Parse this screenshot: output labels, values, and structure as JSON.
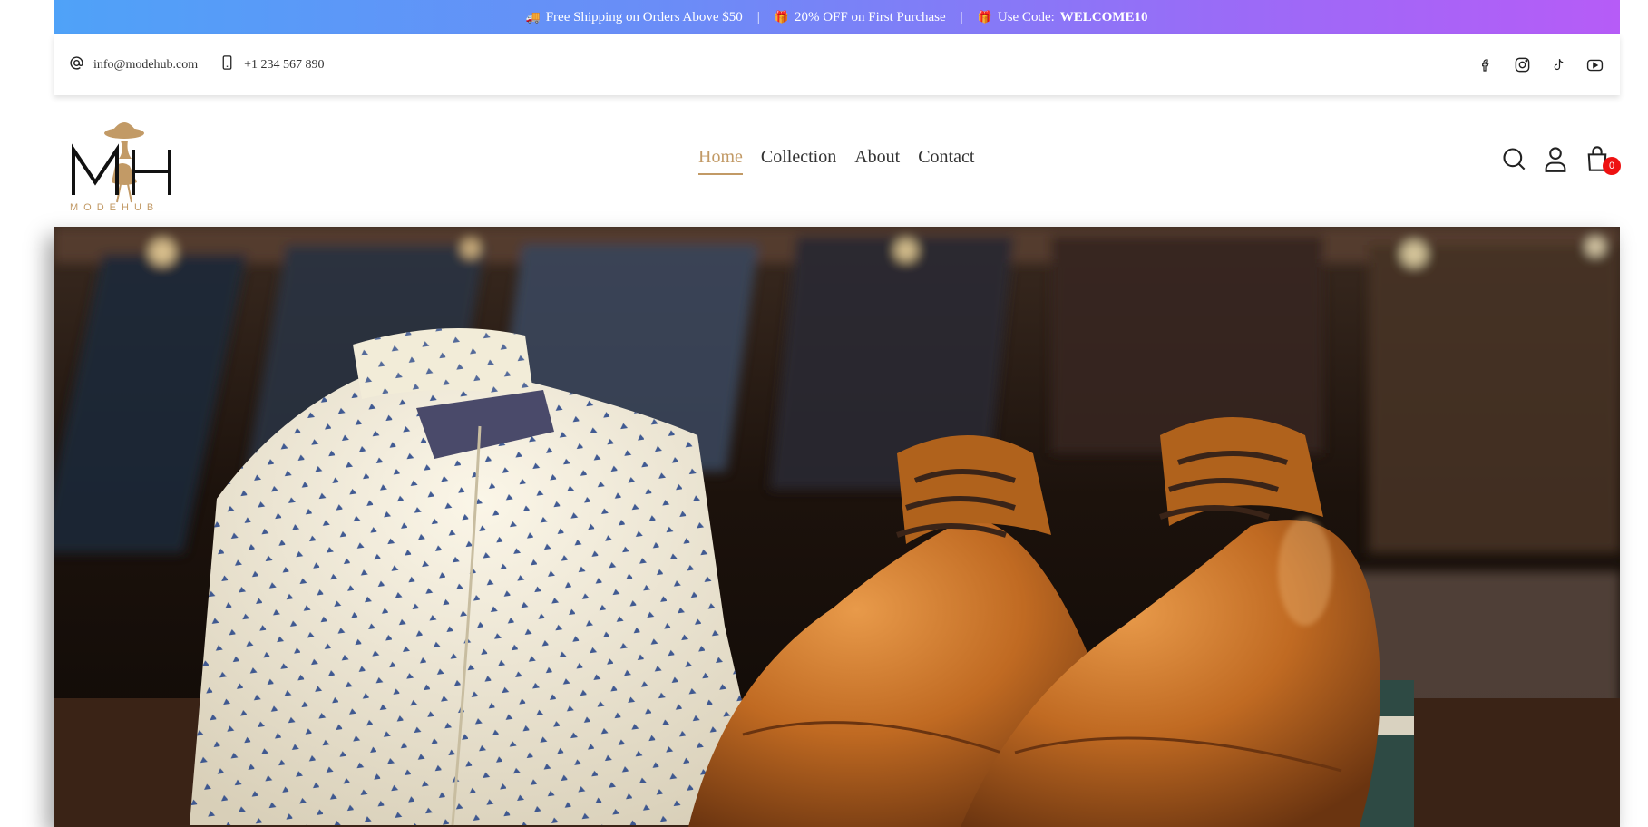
{
  "announcement": {
    "shipping_emoji": "🚚",
    "shipping": "Free Shipping on Orders Above $50",
    "sep": "|",
    "offer_emoji": "🎁",
    "offer": "20% OFF on First Purchase",
    "code_emoji": "🎁",
    "code_prefix": "Use Code:",
    "code": "WELCOME10"
  },
  "contact": {
    "email": "info@modehub.com",
    "phone": "+1 234 567 890"
  },
  "social": [
    "facebook-icon",
    "instagram-icon",
    "tiktok-icon",
    "youtube-icon"
  ],
  "logo": {
    "monogram": "MH",
    "brand": "MODEHUB"
  },
  "nav": [
    {
      "label": "Home",
      "active": true
    },
    {
      "label": "Collection",
      "active": false
    },
    {
      "label": "About",
      "active": false
    },
    {
      "label": "Contact",
      "active": false
    }
  ],
  "cart": {
    "count": "0"
  },
  "colors": {
    "accent": "#c29a66",
    "badge": "#ee1111",
    "gradient_start": "#4fa2f8",
    "gradient_end": "#b65cf7"
  }
}
